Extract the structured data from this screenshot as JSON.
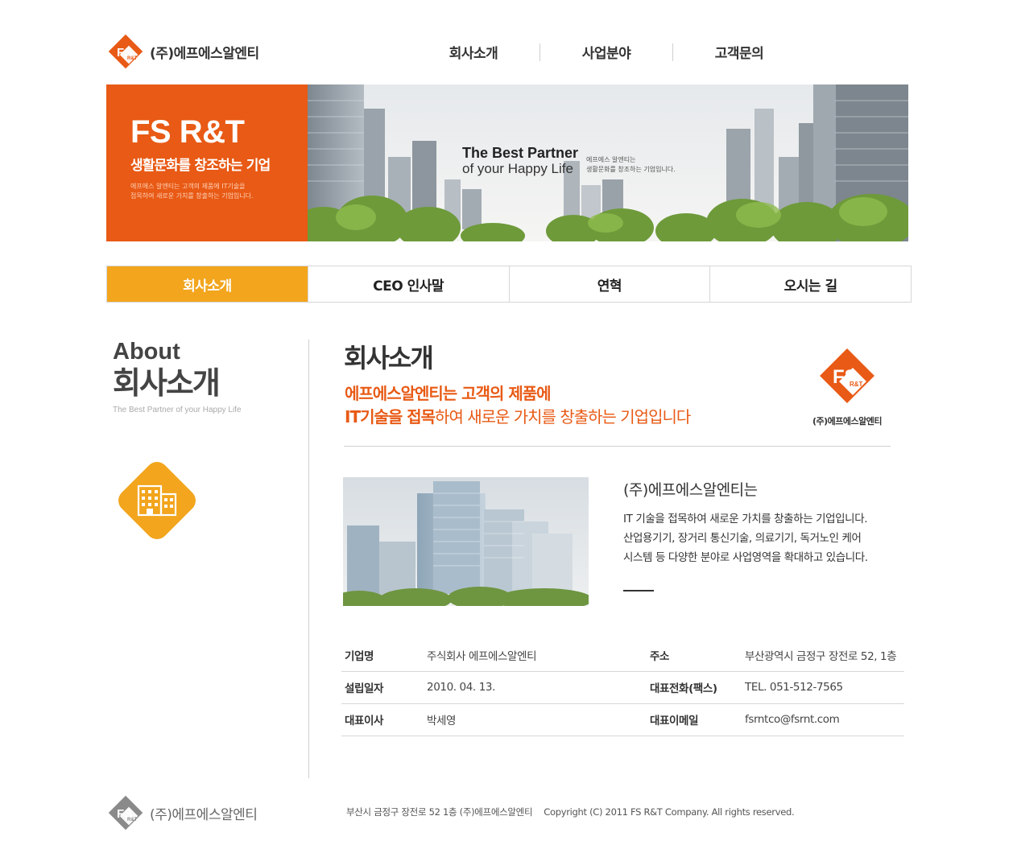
{
  "header": {
    "company_name": "(주)에프에스알엔티",
    "logo_mark": "FS",
    "logo_mark_small": "R&T",
    "nav": [
      "회사소개",
      "사업분야",
      "고객문의"
    ]
  },
  "hero": {
    "title": "FS R&T",
    "subtitle": "생활문화를 창조하는 기업",
    "description_line1": "에프에스 알엔티는 고객의 제품에 IT기술을",
    "description_line2": "접목하여 새로운 가치를 창출하는 기업입니다.",
    "tagline_1": "The Best Partner",
    "tagline_2": "of your Happy Life",
    "tag_note_1": "에프에스 알엔티는",
    "tag_note_2": "생활문화를 창조하는 기업입니다."
  },
  "sub_tabs": [
    "회사소개",
    "CEO 인사말",
    "연혁",
    "오시는 길"
  ],
  "sidebar": {
    "title_en": "About",
    "title_ko": "회사소개",
    "tagline": "The Best Partner of your Happy Life",
    "icon": "building-icon"
  },
  "main": {
    "title": "회사소개",
    "lead_line1": "에프에스알엔티는 고객의 제품에",
    "lead_line2_bold": "IT기술을 접목",
    "lead_line2_rest": "하여 새로운 가치를 창출하는 기업입니다",
    "side_logo_label": "(주)에프에스알엔티",
    "intro_heading": "(주)에프에스알엔티는",
    "intro_body": [
      "IT 기술을 접목하여 새로운 가치를 창출하는 기업입니다.",
      "산업용기기, 장거리 통신기술, 의료기기, 독거노인 케어",
      "시스템 등 다양한 분야로 사업영역을 확대하고 있습니다."
    ],
    "info": [
      {
        "k1": "기업명",
        "v1": "주식회사 에프에스알엔티",
        "k2": "주소",
        "v2": "부산광역시 금정구 장전로 52, 1층"
      },
      {
        "k1": "설립일자",
        "v1": "2010. 04. 13.",
        "k2": "대표전화(팩스)",
        "v2": "TEL. 051-512-7565"
      },
      {
        "k1": "대표이사",
        "v1": "박세영",
        "k2": "대표이메일",
        "v2": "fsrntco@fsrnt.com"
      }
    ]
  },
  "footer": {
    "company_name": "(주)에프에스알엔티",
    "address": "부산시 금정구 장전로 52 1층 (주)에프에스알엔티",
    "copyright": "Copyright (C) 2011 FS R&T Company. All rights reserved."
  },
  "colors": {
    "brand_orange": "#e85a15",
    "tab_active": "#f2a51d",
    "footer_logo_gray": "#8a8a8a"
  }
}
